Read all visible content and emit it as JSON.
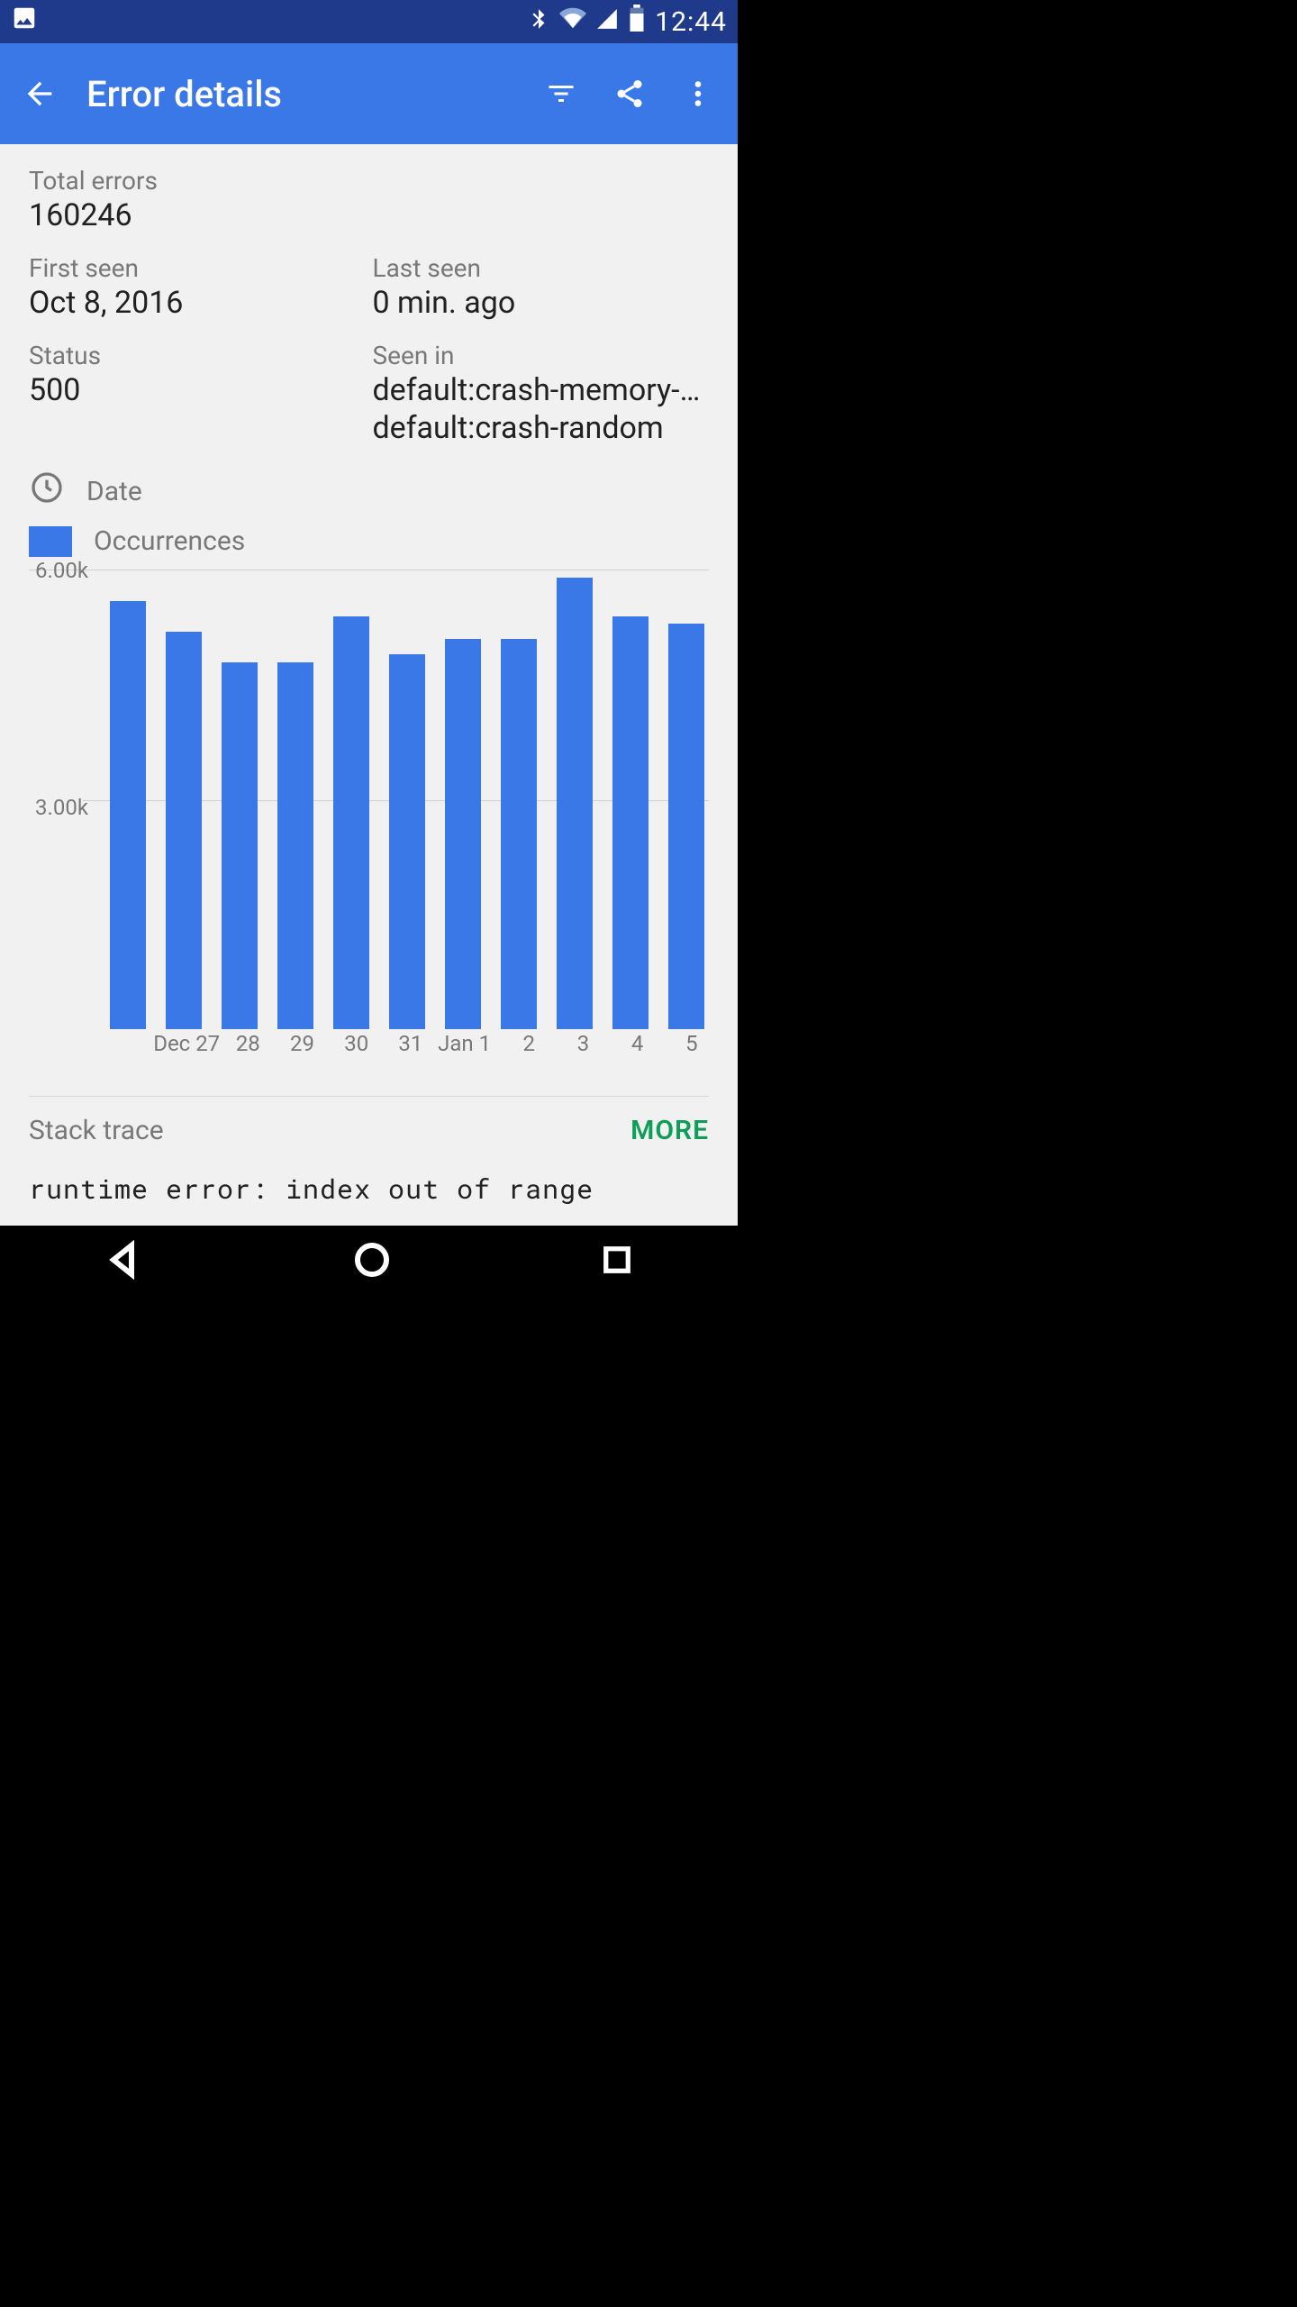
{
  "statusbar": {
    "time": "12:44"
  },
  "appbar": {
    "title": "Error details"
  },
  "summary": {
    "total_errors_label": "Total errors",
    "total_errors_value": "160246",
    "first_seen_label": "First seen",
    "first_seen_value": "Oct 8, 2016",
    "last_seen_label": "Last seen",
    "last_seen_value": "0 min. ago",
    "status_label": "Status",
    "status_value": "500",
    "seen_in_label": "Seen in",
    "seen_in_value_1": "default:crash-memory-acces…",
    "seen_in_value_2": "default:crash-random"
  },
  "legend": {
    "date": "Date",
    "series": "Occurrences"
  },
  "chart_data": {
    "type": "bar",
    "categories": [
      "Dec 27",
      "28",
      "29",
      "30",
      "31",
      "Jan 1",
      "2",
      "3",
      "4",
      "5"
    ],
    "values": [
      5600,
      5200,
      4800,
      4800,
      5400,
      4900,
      5100,
      5100,
      5900,
      5400,
      5300
    ],
    "title": "",
    "xlabel": "",
    "ylabel": "",
    "ylim": [
      0,
      6000
    ],
    "yticks": [
      "6.00k",
      "3.00k"
    ]
  },
  "stacktrace": {
    "header": "Stack trace",
    "more": "MORE",
    "line": "runtime error: index out of range"
  },
  "colors": {
    "accent": "#3b78e7",
    "more": "#0f9d58"
  }
}
